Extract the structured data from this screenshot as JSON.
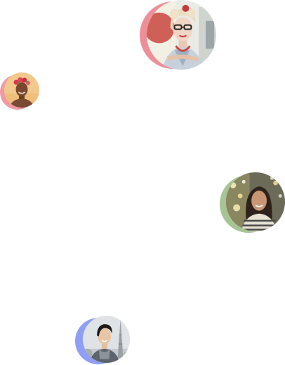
{
  "avatars": [
    {
      "id": "avatar-1",
      "ring_color": "#ec8f99",
      "description_icon": "woman-glasses-photo-icon"
    },
    {
      "id": "avatar-2",
      "ring_color": "#ef9aa6",
      "description_icon": "man-flower-crown-photo-icon"
    },
    {
      "id": "avatar-3",
      "ring_color": "#a7c494",
      "description_icon": "woman-lights-photo-icon"
    },
    {
      "id": "avatar-4",
      "ring_color": "#8f9ff3",
      "description_icon": "man-eiffel-tower-photo-icon"
    }
  ],
  "colors": {
    "background": "#ffffff"
  }
}
